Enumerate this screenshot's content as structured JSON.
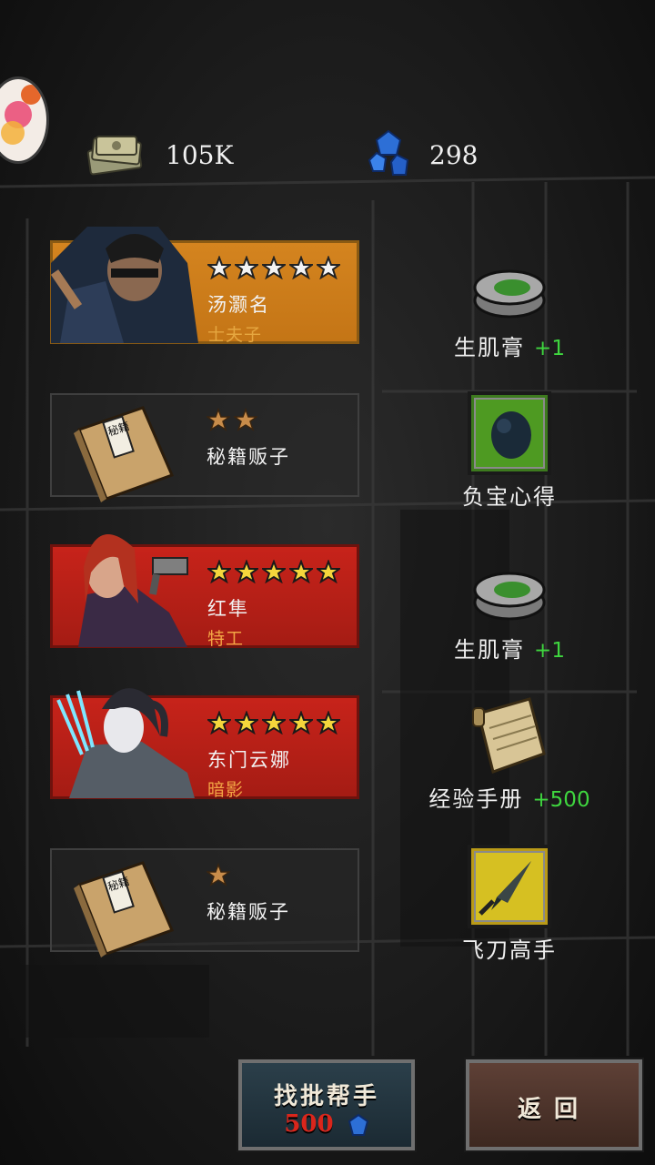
{
  "currencies": {
    "cash": "105K",
    "gems": "298"
  },
  "cards": [
    {
      "type": "hero",
      "style": "gold",
      "stars": 5,
      "star_style": "outline",
      "name": "汤灏名",
      "title": "士夫子"
    },
    {
      "type": "book",
      "style": "dark",
      "stars": 2,
      "name": "秘籍贩子",
      "book_label": "秘籍"
    },
    {
      "type": "hero",
      "style": "red",
      "stars": 5,
      "star_style": "gold",
      "name": "红隼",
      "title": "特工"
    },
    {
      "type": "hero",
      "style": "red",
      "stars": 5,
      "star_style": "gold",
      "name": "东门云娜",
      "title": "暗影"
    },
    {
      "type": "book",
      "style": "dark",
      "stars": 1,
      "name": "秘籍贩子",
      "book_label": "秘籍"
    }
  ],
  "rewards": [
    {
      "icon": "ointment-tin-icon",
      "label": "生肌膏",
      "amount": "+1"
    },
    {
      "icon": "treasure-skill-icon",
      "label": "负宝心得",
      "amount": ""
    },
    {
      "icon": "ointment-tin-icon",
      "label": "生肌膏",
      "amount": "+1"
    },
    {
      "icon": "scroll-icon",
      "label": "经验手册",
      "amount": "+500"
    },
    {
      "icon": "flying-knife-skill-icon",
      "label": "飞刀高手",
      "amount": ""
    }
  ],
  "buttons": {
    "find_helper": "找批帮手",
    "find_cost": "500",
    "back": "返回"
  },
  "colors": {
    "gold_card": "#d4841f",
    "red_card": "#c7231a",
    "bonus_green": "#3fd63f",
    "cost_red": "#d9261c"
  }
}
